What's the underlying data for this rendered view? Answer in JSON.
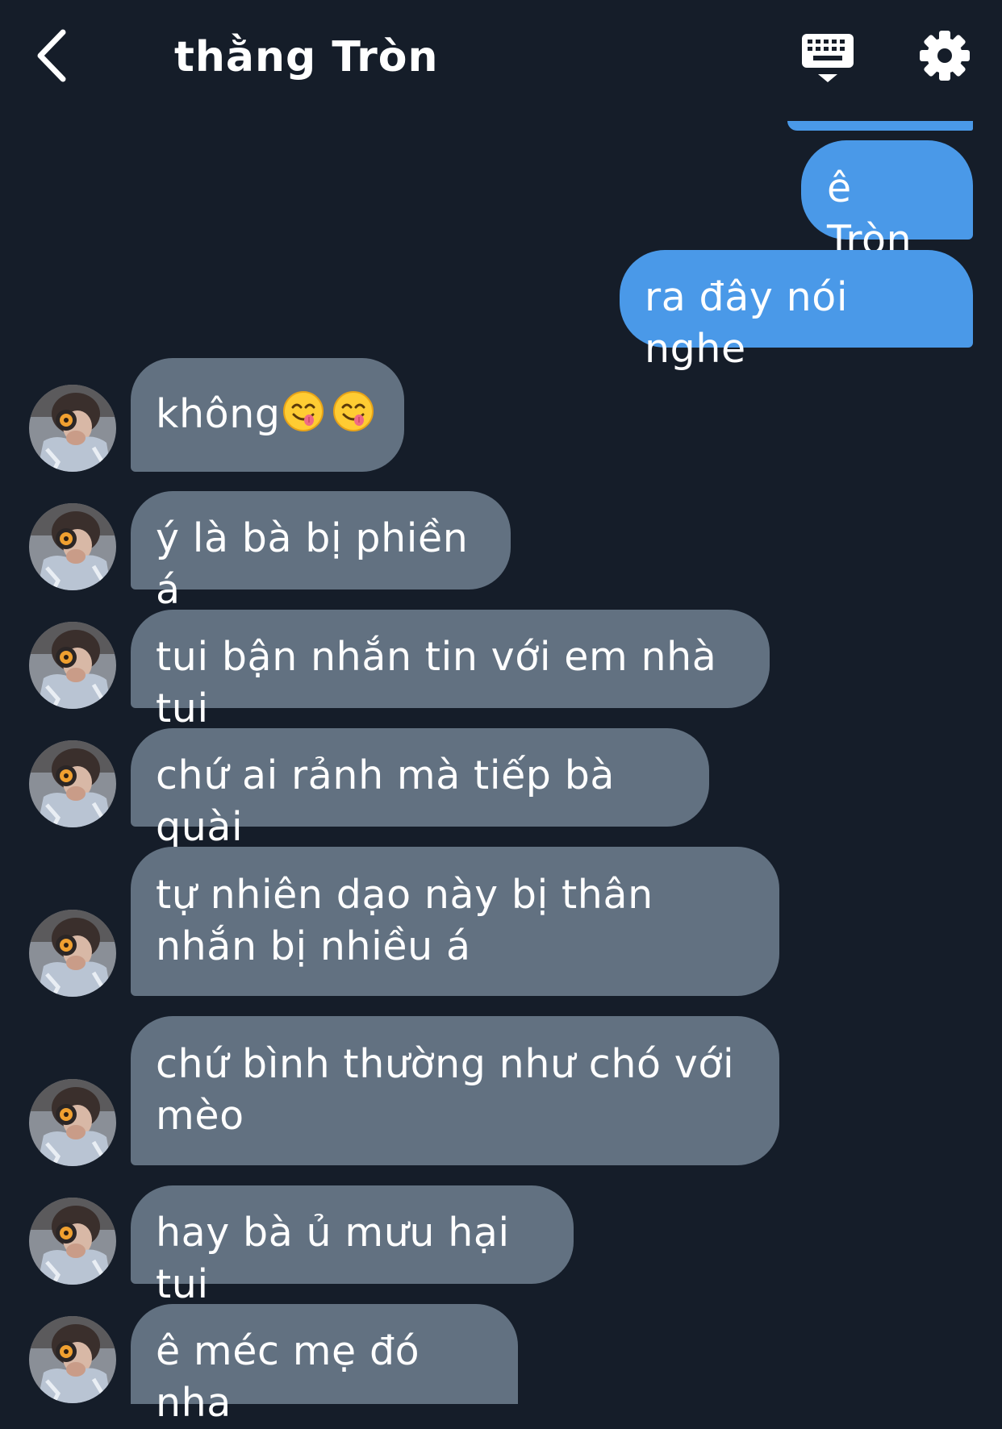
{
  "header": {
    "title": "thằng Tròn",
    "back_icon": "chevron-left-icon",
    "keyboard_icon": "keyboard-icon",
    "settings_icon": "gear-icon"
  },
  "colors": {
    "background": "#151d29",
    "outgoing_bubble": "#4a99e8",
    "incoming_bubble": "#627181",
    "text": "#ffffff"
  },
  "messages": {
    "outgoing": [
      {
        "text": "ê Tròn"
      },
      {
        "text": "ra đây nói nghe"
      }
    ],
    "incoming": [
      {
        "text": "không",
        "emojis": [
          "face-savoring-food-emoji",
          "face-savoring-food-emoji"
        ]
      },
      {
        "text": "ý là bà bị phiền á"
      },
      {
        "text": "tui bận nhắn tin với em nhà tui"
      },
      {
        "text": "chứ ai rảnh mà tiếp bà quài"
      },
      {
        "text": "tự nhiên dạo này bị thân nhắn bị nhiều á"
      },
      {
        "text": "chứ bình thường như chó với mèo"
      },
      {
        "text": "hay bà ủ mưu hại tui"
      },
      {
        "text": "ê méc mẹ đó nha"
      }
    ]
  }
}
